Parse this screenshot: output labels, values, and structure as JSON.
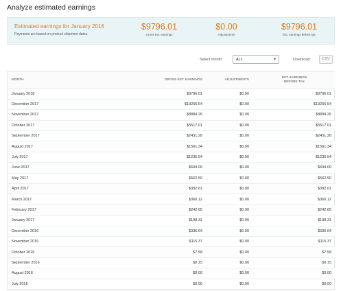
{
  "page_title": "Analyze estimated earnings",
  "summary": {
    "heading": "Estimated earnings for January 2018",
    "note": "Payments are based on product shipment dates.",
    "metrics": [
      {
        "value": "$9796.01",
        "label": "Gross est. earnings"
      },
      {
        "value": "$0.00",
        "label": "Adjustments"
      },
      {
        "value": "$9796.01",
        "label": "Est. earnings before tax"
      }
    ]
  },
  "controls": {
    "select_month_label": "Select month:",
    "select_month_value": "ALL",
    "download_label": "Download:",
    "csv_label": "CSV"
  },
  "table": {
    "headers": {
      "month": "MONTH",
      "gross": "GROSS EST. EARNINGS",
      "adjustments": "ADJUSTMENTS",
      "est_line1": "EST. EARNINGS",
      "est_line2": "BEFORE TAX"
    },
    "rows": [
      {
        "month": "January 2018",
        "gross": "$9796.01",
        "adjustments": "$0.00",
        "est": "$9796.01"
      },
      {
        "month": "December 2017",
        "gross": "$19256.54",
        "adjustments": "$0.00",
        "est": "$19256.54"
      },
      {
        "month": "November 2017",
        "gross": "$8884.26",
        "adjustments": "$0.00",
        "est": "$8884.26"
      },
      {
        "month": "October 2017",
        "gross": "$5517.01",
        "adjustments": "$0.00",
        "est": "$5517.01"
      },
      {
        "month": "September 2017",
        "gross": "$2451.28",
        "adjustments": "$0.00",
        "est": "$2451.28"
      },
      {
        "month": "August 2017",
        "gross": "$1561.34",
        "adjustments": "$0.00",
        "est": "$1561.34"
      },
      {
        "month": "July 2017",
        "gross": "$1235.54",
        "adjustments": "$0.00",
        "est": "$1235.54"
      },
      {
        "month": "June 2017",
        "gross": "$694.09",
        "adjustments": "$0.00",
        "est": "$694.09"
      },
      {
        "month": "May 2017",
        "gross": "$562.50",
        "adjustments": "$0.00",
        "est": "$562.50"
      },
      {
        "month": "April 2017",
        "gross": "$392.61",
        "adjustments": "$0.00",
        "est": "$392.61"
      },
      {
        "month": "March 2017",
        "gross": "$360.12",
        "adjustments": "$0.00",
        "est": "$360.12"
      },
      {
        "month": "February 2017",
        "gross": "$242.65",
        "adjustments": "$0.00",
        "est": "$242.65"
      },
      {
        "month": "January 2017",
        "gross": "$198.31",
        "adjustments": "$0.00",
        "est": "$198.31"
      },
      {
        "month": "December 2016",
        "gross": "$336.64",
        "adjustments": "$0.00",
        "est": "$336.64"
      },
      {
        "month": "November 2016",
        "gross": "$115.37",
        "adjustments": "$0.00",
        "est": "$115.37"
      },
      {
        "month": "October 2016",
        "gross": "$7.58",
        "adjustments": "$0.00",
        "est": "$7.58"
      },
      {
        "month": "September 2016",
        "gross": "$0.15",
        "adjustments": "$0.00",
        "est": "$0.15"
      },
      {
        "month": "August 2016",
        "gross": "$0.00",
        "adjustments": "$0.00",
        "est": "$0.00"
      },
      {
        "month": "July 2016",
        "gross": "$0.00",
        "adjustments": "$0.00",
        "est": "$0.00"
      }
    ]
  },
  "colors": {
    "accent": "#e47911",
    "summary_bg": "#e9f4f6"
  },
  "icons": {
    "select_chevron": "chevron-down-icon"
  }
}
